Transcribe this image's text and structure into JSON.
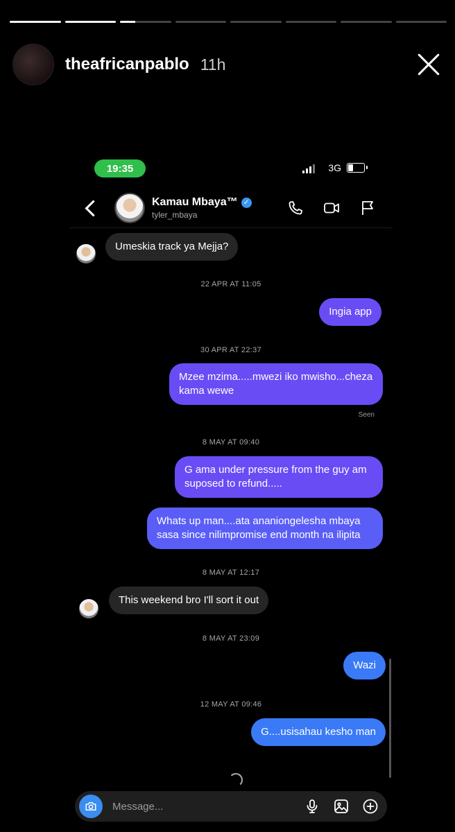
{
  "story": {
    "username": "theafricanpablo",
    "time_ago": "11h",
    "progress": [
      1,
      1,
      0.3,
      0,
      0,
      0,
      0,
      0
    ]
  },
  "phone": {
    "status_time": "19:35",
    "network": "3G",
    "battery_level": 0.35
  },
  "chat": {
    "contact_name": "Kamau Mbaya™",
    "contact_username": "tyler_mbaya",
    "verified_mark": "✓"
  },
  "messages": [
    {
      "type": "in",
      "text": "Umeskia track ya Mejja?"
    },
    {
      "type": "timestamp",
      "text": "22 APR AT 11:05"
    },
    {
      "type": "out",
      "text": "Ingia app"
    },
    {
      "type": "timestamp",
      "text": "30 APR AT 22:37"
    },
    {
      "type": "out",
      "text": "Mzee mzima.....mwezi iko mwisho...cheza kama wewe"
    },
    {
      "type": "seen",
      "text": "Seen"
    },
    {
      "type": "timestamp",
      "text": "8 MAY AT 09:40"
    },
    {
      "type": "out",
      "text": "G ama under pressure from the guy am suposed to refund....."
    },
    {
      "type": "out",
      "text": "Whats up man....ata ananiongelesha mbaya sasa  since nilimpromise end month na ilipita"
    },
    {
      "type": "timestamp",
      "text": "8 MAY AT 12:17"
    },
    {
      "type": "in",
      "text": "This weekend bro I'll sort it out"
    },
    {
      "type": "timestamp",
      "text": "8 MAY AT 23:09"
    },
    {
      "type": "out",
      "text": "Wazi"
    },
    {
      "type": "timestamp",
      "text": "12 MAY AT 09:46"
    },
    {
      "type": "out",
      "text": "G....usisahau kesho man"
    }
  ],
  "composer": {
    "placeholder": "Message..."
  },
  "colors": {
    "bubble_in": "#262626",
    "bubble_purple": "#6a4cf5",
    "bubble_indigo": "#5a5ef7",
    "bubble_blue": "#3a7af7",
    "status_green": "#2fbf4a",
    "verified_blue": "#3b97f3"
  },
  "icons": [
    "close-icon",
    "back-icon",
    "verified-icon",
    "phone-call-icon",
    "video-call-icon",
    "flag-icon",
    "camera-icon",
    "microphone-icon",
    "gallery-icon",
    "add-icon",
    "loading-spinner-icon"
  ]
}
